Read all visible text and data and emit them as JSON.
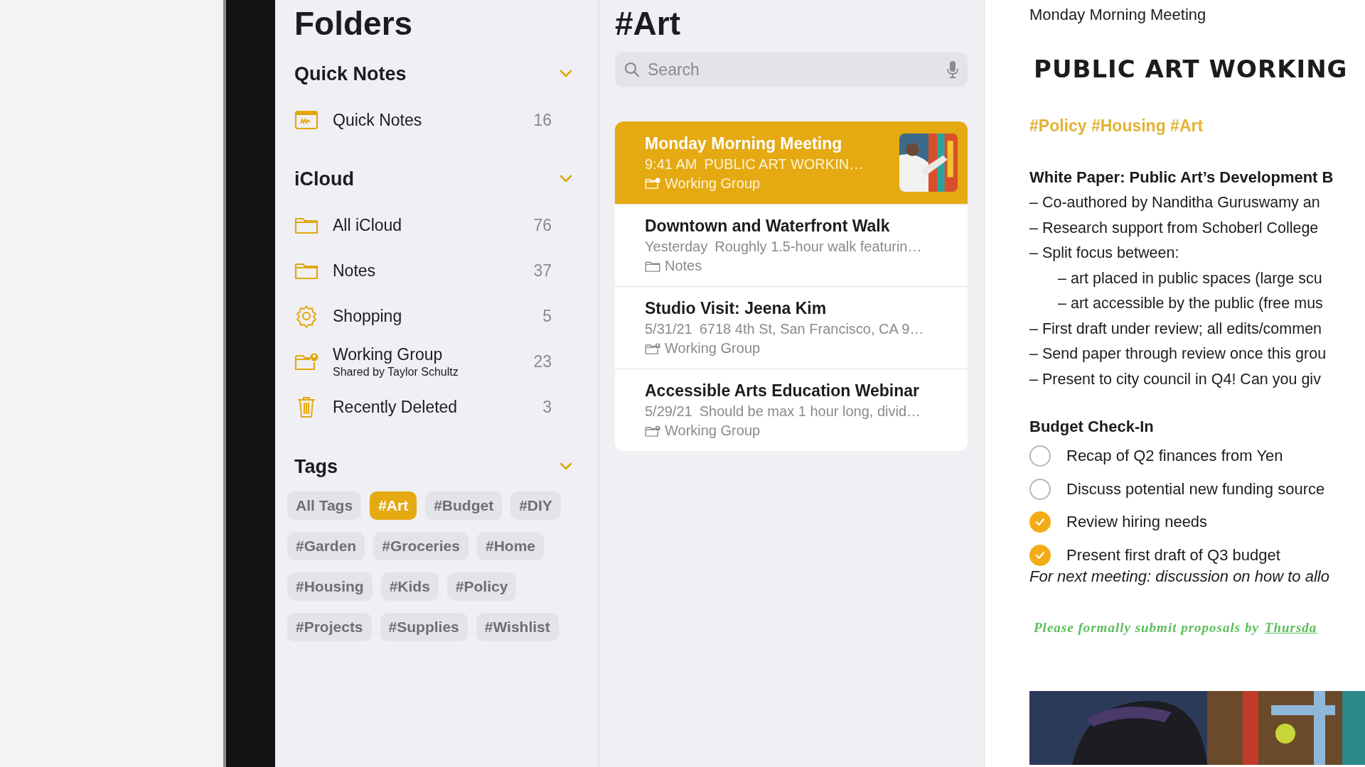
{
  "sidebar": {
    "title": "Folders",
    "sections": [
      {
        "title": "Quick Notes",
        "expanded": true,
        "items": [
          {
            "kind": "quick-note",
            "label": "Quick Notes",
            "count": "16"
          }
        ]
      },
      {
        "title": "iCloud",
        "expanded": true,
        "items": [
          {
            "kind": "folder",
            "label": "All iCloud",
            "count": "76"
          },
          {
            "kind": "folder",
            "label": "Notes",
            "count": "37"
          },
          {
            "kind": "gear",
            "label": "Shopping",
            "count": "5"
          },
          {
            "kind": "shared-folder",
            "label": "Working Group",
            "subtitle": "Shared by Taylor Schultz",
            "count": "23"
          },
          {
            "kind": "trash",
            "label": "Recently Deleted",
            "count": "3"
          }
        ]
      }
    ],
    "tags": {
      "title": "Tags",
      "expanded": true,
      "items": [
        {
          "label": "All Tags",
          "selected": false
        },
        {
          "label": "#Art",
          "selected": true
        },
        {
          "label": "#Budget",
          "selected": false
        },
        {
          "label": "#DIY",
          "selected": false
        },
        {
          "label": "#Garden",
          "selected": false
        },
        {
          "label": "#Groceries",
          "selected": false
        },
        {
          "label": "#Home",
          "selected": false
        },
        {
          "label": "#Housing",
          "selected": false
        },
        {
          "label": "#Kids",
          "selected": false
        },
        {
          "label": "#Policy",
          "selected": false
        },
        {
          "label": "#Projects",
          "selected": false
        },
        {
          "label": "#Supplies",
          "selected": false
        },
        {
          "label": "#Wishlist",
          "selected": false
        }
      ]
    }
  },
  "note_list": {
    "title": "#Art",
    "search": {
      "placeholder": "Search"
    },
    "notes": [
      {
        "title": "Monday Morning Meeting",
        "date": "9:41 AM",
        "preview": "PUBLIC ART WORKIN…",
        "folder": {
          "text": "Working Group",
          "kind": "shared-folder"
        },
        "selected": true,
        "thumbnail": {
          "kind": "picture"
        }
      },
      {
        "title": "Downtown and Waterfront Walk",
        "date": "Yesterday",
        "preview": "Roughly 1.5-hour walk featurin…",
        "folder": {
          "text": "Notes",
          "kind": "folder"
        },
        "selected": false
      },
      {
        "title": "Studio Visit: Jeena Kim",
        "date": "5/31/21",
        "preview": "6718 4th St, San Francisco, CA 9…",
        "folder": {
          "text": "Working Group",
          "kind": "shared-folder"
        },
        "selected": false
      },
      {
        "title": "Accessible Arts Education Webinar",
        "date": "5/29/21",
        "preview": "Should be max 1 hour long, divid…",
        "folder": {
          "text": "Working Group",
          "kind": "shared-folder"
        },
        "selected": false
      }
    ]
  },
  "note": {
    "title": "Monday Morning Meeting",
    "heading": "PUBLIC ART WORKING",
    "tags": "#Policy #Housing #Art",
    "blocks": [
      {
        "kind": "subheading",
        "text": "White Paper: Public Art’s Development B"
      },
      {
        "kind": "dash",
        "text": "– Co-authored by Nanditha Guruswamy an"
      },
      {
        "kind": "dash",
        "text": "– Research support from Schoberl College"
      },
      {
        "kind": "dash",
        "text": "– Split focus between:",
        "children": [
          {
            "kind": "dash",
            "text": "– art placed in public spaces (large scu"
          },
          {
            "kind": "dash",
            "text": "– art accessible by the public (free mus"
          }
        ]
      },
      {
        "kind": "dash",
        "text": "– First draft under review; all edits/commen"
      },
      {
        "kind": "dash",
        "text": "– Send paper through review once this grou"
      },
      {
        "kind": "dash",
        "text": "– Present to city council in Q4! Can you giv"
      },
      {
        "kind": "subheading",
        "text": "Budget Check-In"
      },
      {
        "kind": "check",
        "text": "Recap of Q2 finances from Yen",
        "checked": false
      },
      {
        "kind": "check",
        "text": "Discuss potential new funding source",
        "checked": false
      },
      {
        "kind": "check",
        "text": "Review hiring needs",
        "checked": true
      },
      {
        "kind": "check",
        "text": "Present first draft of Q3 budget",
        "checked": true
      },
      {
        "kind": "italic",
        "text": "For next meeting: discussion on how to allo"
      },
      {
        "kind": "handwriting",
        "text": "Please formally submit proposals by",
        "link": "Thursda"
      },
      {
        "kind": "picture"
      }
    ]
  }
}
